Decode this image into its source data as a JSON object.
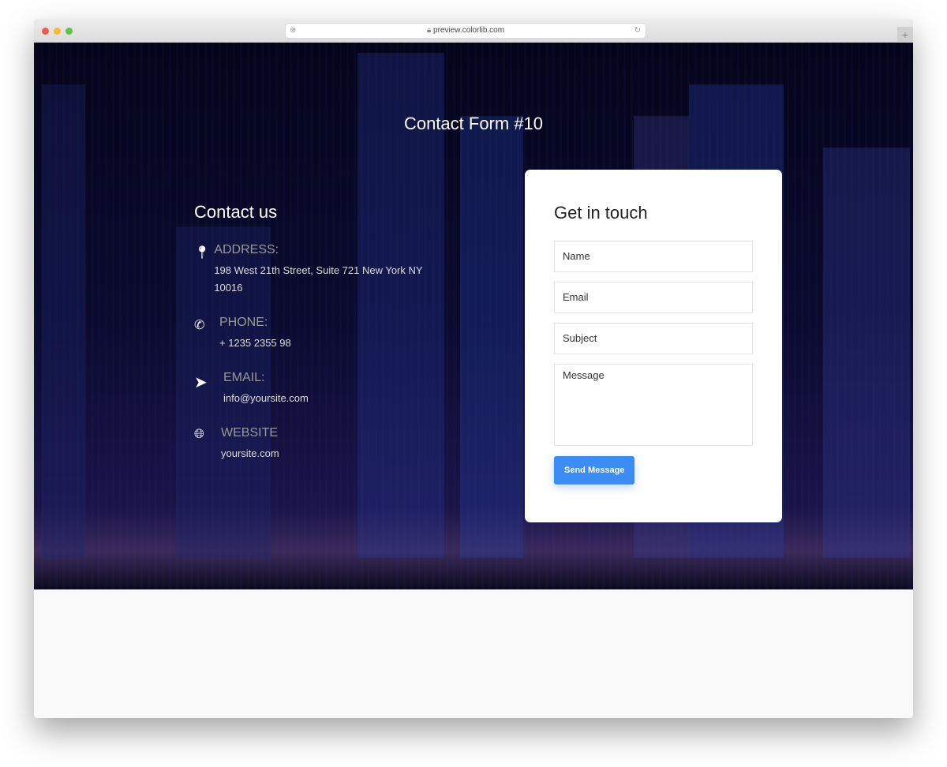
{
  "browser": {
    "url": "preview.colorlib.com",
    "traffic_lights": [
      "#ee5a52",
      "#f4bd2f",
      "#5fc53f"
    ]
  },
  "page": {
    "title": "Contact Form #10"
  },
  "contact": {
    "heading": "Contact us",
    "items": [
      {
        "icon": "map-pin-icon",
        "label": "ADDRESS:",
        "value": "198 West 21th Street, Suite 721 New York NY 10016"
      },
      {
        "icon": "phone-icon",
        "label": "PHONE:",
        "value": "+ 1235 2355 98"
      },
      {
        "icon": "paper-plane-icon",
        "label": "EMAIL:",
        "value": "info@yoursite.com"
      },
      {
        "icon": "globe-icon",
        "label": "WEBSITE",
        "value": "yoursite.com"
      }
    ]
  },
  "form": {
    "heading": "Get in touch",
    "name_placeholder": "Name",
    "email_placeholder": "Email",
    "subject_placeholder": "Subject",
    "message_placeholder": "Message",
    "submit_label": "Send Message",
    "accent": "#3b8cf4"
  }
}
